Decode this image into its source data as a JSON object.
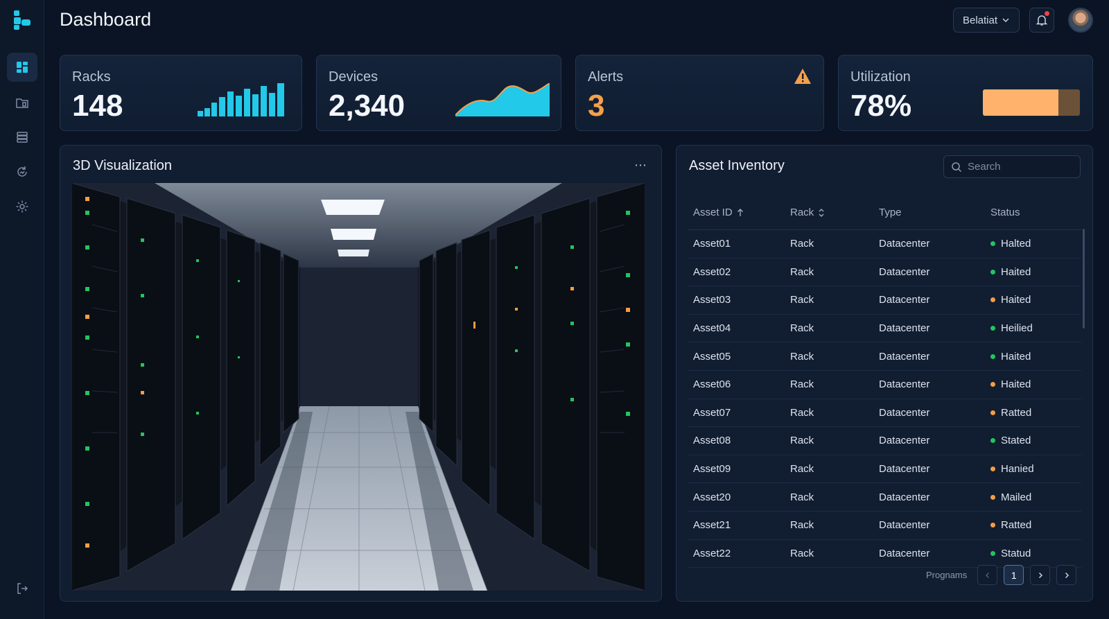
{
  "header": {
    "title": "Dashboard",
    "user_select": "Belatiat"
  },
  "sidebar": {
    "items": [
      {
        "name": "dashboard",
        "active": true
      },
      {
        "name": "folder"
      },
      {
        "name": "server"
      },
      {
        "name": "refresh"
      },
      {
        "name": "settings"
      }
    ],
    "logout": "logout-icon"
  },
  "kpis": {
    "racks": {
      "label": "Racks",
      "value": "148"
    },
    "devices": {
      "label": "Devices",
      "value": "2,340"
    },
    "alerts": {
      "label": "Alerts",
      "value": "3"
    },
    "utilization": {
      "label": "Utilization",
      "value": "78%",
      "fill": 0.78
    }
  },
  "viz": {
    "title": "3D Visualization",
    "more": "⋯"
  },
  "inventory": {
    "title": "Asset Inventory",
    "search_placeholder": "Search",
    "columns": [
      "Asset ID",
      "Rack",
      "Type",
      "Status"
    ],
    "rows": [
      {
        "id": "Asset01",
        "rack": "Rack",
        "type": "Datacenter",
        "status": "Halted",
        "color": "#22c55e"
      },
      {
        "id": "Asset02",
        "rack": "Rack",
        "type": "Datacenter",
        "status": "Haited",
        "color": "#22c55e"
      },
      {
        "id": "Asset03",
        "rack": "Rack",
        "type": "Datacenter",
        "status": "Haited",
        "color": "#f59e42"
      },
      {
        "id": "Asset04",
        "rack": "Rack",
        "type": "Datacenter",
        "status": "Heilied",
        "color": "#22c55e"
      },
      {
        "id": "Asset05",
        "rack": "Rack",
        "type": "Datacenter",
        "status": "Haited",
        "color": "#22c55e"
      },
      {
        "id": "Asset06",
        "rack": "Rack",
        "type": "Datacenter",
        "status": "Haited",
        "color": "#f59e42"
      },
      {
        "id": "Asset07",
        "rack": "Rack",
        "type": "Datacenter",
        "status": "Ratted",
        "color": "#f59e42"
      },
      {
        "id": "Asset08",
        "rack": "Rack",
        "type": "Datacenter",
        "status": "Stated",
        "color": "#22c55e"
      },
      {
        "id": "Asset09",
        "rack": "Rack",
        "type": "Datacenter",
        "status": "Hanied",
        "color": "#f59e42"
      },
      {
        "id": "Asset20",
        "rack": "Rack",
        "type": "Datacenter",
        "status": "Mailed",
        "color": "#f59e42"
      },
      {
        "id": "Asset21",
        "rack": "Rack",
        "type": "Datacenter",
        "status": "Ratted",
        "color": "#f59e42"
      },
      {
        "id": "Asset22",
        "rack": "Rack",
        "type": "Datacenter",
        "status": "Statud",
        "color": "#22c55e"
      }
    ],
    "pagination": {
      "label": "Prognams",
      "current": "1"
    }
  },
  "colors": {
    "accent": "#22c9e8",
    "warning": "#f5a14a",
    "util_fill": "#ffb26b",
    "background": "#0b1424"
  }
}
